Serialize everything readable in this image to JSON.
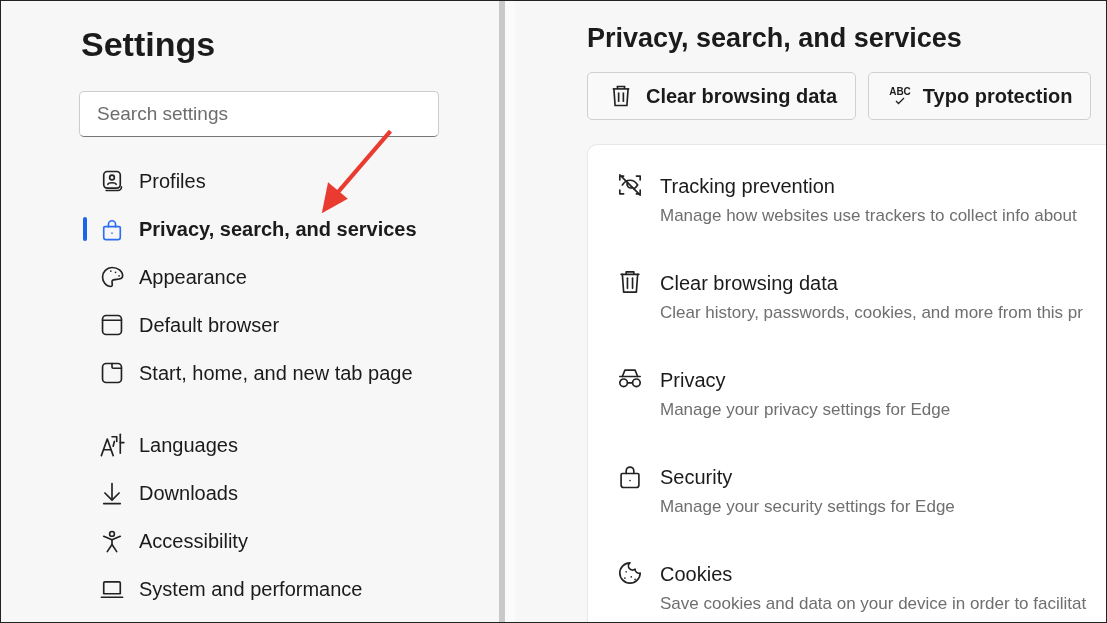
{
  "sidebar": {
    "title": "Settings",
    "search": {
      "placeholder": "Search settings"
    },
    "groups": [
      [
        {
          "label": "Profiles",
          "selected": false
        },
        {
          "label": "Privacy, search, and services",
          "selected": true
        },
        {
          "label": "Appearance",
          "selected": false
        },
        {
          "label": "Default browser",
          "selected": false
        },
        {
          "label": "Start, home, and new tab page",
          "selected": false
        }
      ],
      [
        {
          "label": "Languages",
          "selected": false
        },
        {
          "label": "Downloads",
          "selected": false
        },
        {
          "label": "Accessibility",
          "selected": false
        },
        {
          "label": "System and performance",
          "selected": false
        }
      ]
    ]
  },
  "main": {
    "title": "Privacy, search, and services",
    "buttons": [
      {
        "label": "Clear browsing data"
      },
      {
        "label": "Typo protection",
        "icon_text": "ABC"
      }
    ],
    "items": [
      {
        "title": "Tracking prevention",
        "description": "Manage how websites use trackers to collect info about"
      },
      {
        "title": "Clear browsing data",
        "description": "Clear history, passwords, cookies, and more from this pr"
      },
      {
        "title": "Privacy",
        "description": "Manage your privacy settings for Edge"
      },
      {
        "title": "Security",
        "description": "Manage your security settings for Edge"
      },
      {
        "title": "Cookies",
        "description": "Save cookies and data on your device in order to facilitat"
      }
    ]
  }
}
